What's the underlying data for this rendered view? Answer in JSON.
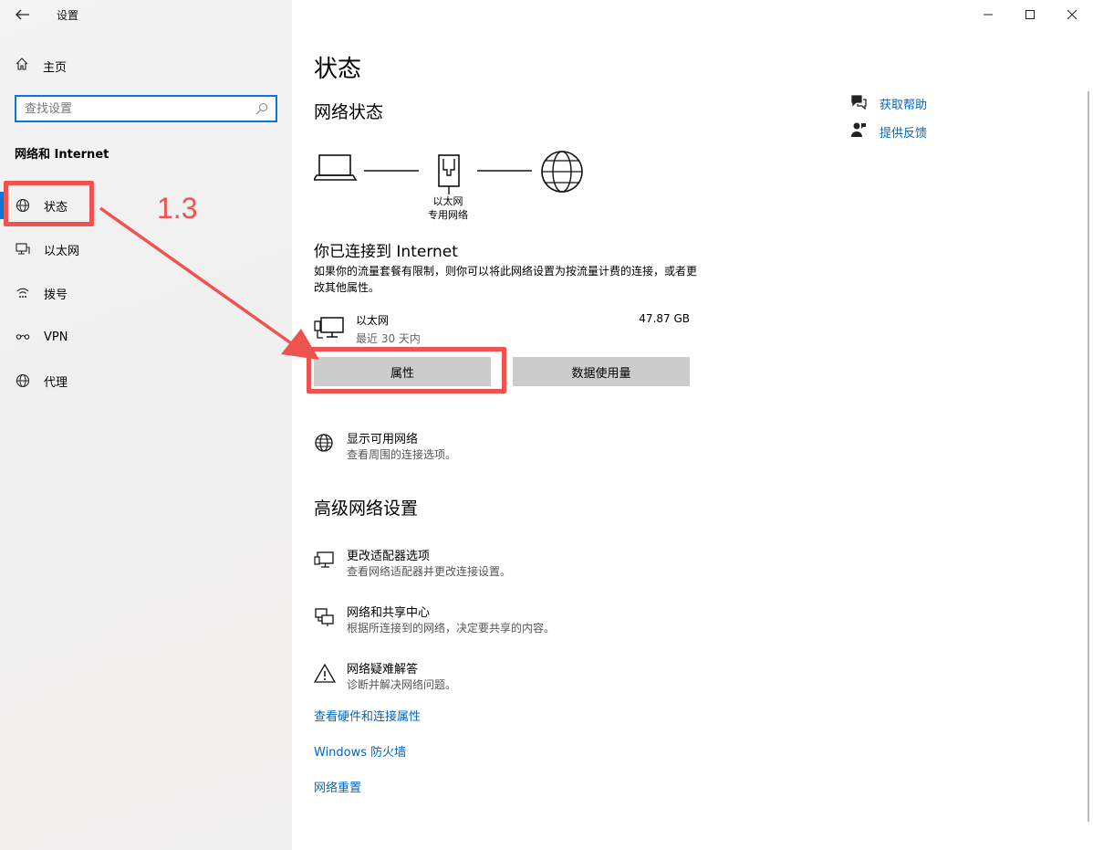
{
  "window": {
    "title": "设置",
    "minimize": "—",
    "maximize": "☐",
    "close": "✕"
  },
  "sidebar": {
    "home": "主页",
    "search_placeholder": "查找设置",
    "section": "网络和 Internet",
    "items": [
      {
        "label": "状态",
        "icon": "globe-icon"
      },
      {
        "label": "以太网",
        "icon": "ethernet-icon"
      },
      {
        "label": "拨号",
        "icon": "dialup-icon"
      },
      {
        "label": "VPN",
        "icon": "vpn-icon"
      },
      {
        "label": "代理",
        "icon": "globe-icon"
      }
    ]
  },
  "annotation": {
    "label": "1.3",
    "color": "#ef5350"
  },
  "main": {
    "title": "状态",
    "network_status": "网络状态",
    "diagram_label_line1": "以太网",
    "diagram_label_line2": "专用网络",
    "connected_title": "你已连接到 Internet",
    "connected_desc": "如果你的流量套餐有限制，则你可以将此网络设置为按流量计费的连接，或者更改其他属性。",
    "ethernet": {
      "name": "以太网",
      "sub": "最近 30 天内",
      "size": "47.87 GB"
    },
    "buttons": {
      "properties": "属性",
      "data_usage": "数据使用量"
    },
    "show_networks": {
      "title": "显示可用网络",
      "sub": "查看周围的连接选项。"
    },
    "advanced_title": "高级网络设置",
    "advanced": [
      {
        "title": "更改适配器选项",
        "sub": "查看网络适配器并更改连接设置。"
      },
      {
        "title": "网络和共享中心",
        "sub": "根据所连接到的网络，决定要共享的内容。"
      },
      {
        "title": "网络疑难解答",
        "sub": "诊断并解决网络问题。"
      }
    ],
    "links": [
      "查看硬件和连接属性",
      "Windows 防火墙",
      "网络重置"
    ]
  },
  "help": {
    "get_help": "获取帮助",
    "feedback": "提供反馈"
  },
  "colors": {
    "accent": "#0a78d7",
    "link": "#0067c0",
    "annotation": "#ef5350"
  }
}
